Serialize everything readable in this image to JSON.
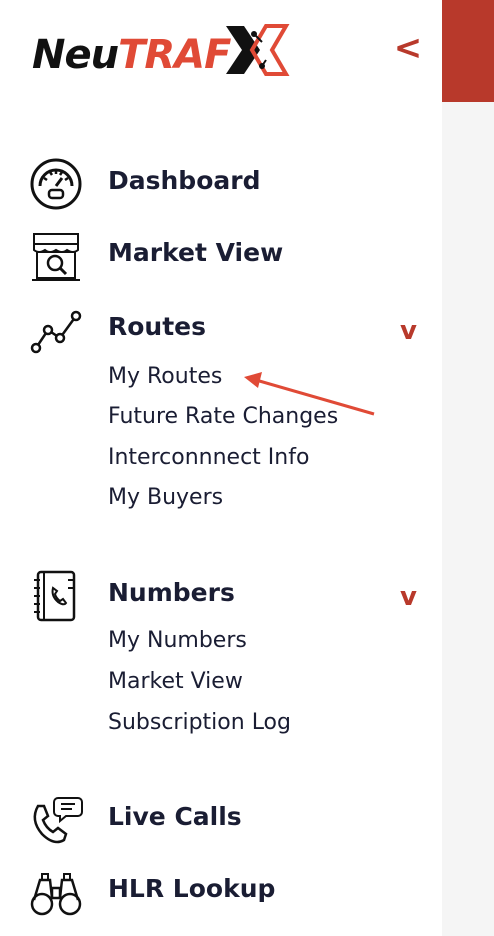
{
  "brand": {
    "name_part1": "Neu",
    "name_part2": "TRAF",
    "accent_color": "#b8392b",
    "logo_red": "#e04a36"
  },
  "header": {
    "collapse_icon": "chevron-left-icon",
    "collapse_symbol": "<"
  },
  "nav": {
    "dashboard": {
      "label": "Dashboard",
      "icon": "gauge-icon"
    },
    "market_view": {
      "label": "Market View",
      "icon": "storefront-icon"
    },
    "routes": {
      "label": "Routes",
      "icon": "route-graph-icon",
      "chevron": "v",
      "sub": [
        "My Routes",
        "Future Rate Changes",
        "Interconnnect Info",
        "My Buyers"
      ]
    },
    "numbers": {
      "label": "Numbers",
      "icon": "phonebook-icon",
      "chevron": "v",
      "sub": [
        "My Numbers",
        "Market View",
        "Subscription Log"
      ]
    },
    "live_calls": {
      "label": "Live Calls",
      "icon": "phone-chat-icon"
    },
    "hlr_lookup": {
      "label": "HLR Lookup",
      "icon": "binoculars-icon"
    }
  }
}
